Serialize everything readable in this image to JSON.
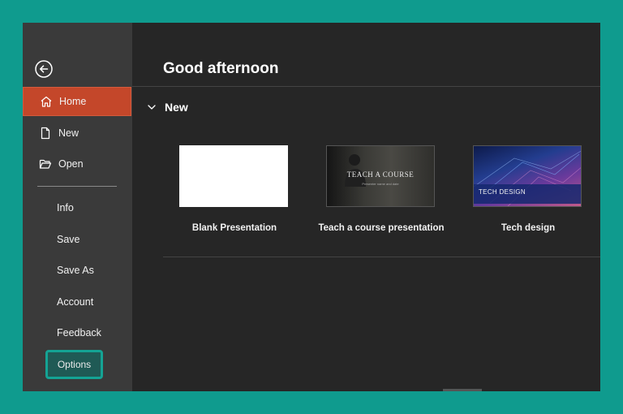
{
  "sidebar": {
    "home": "Home",
    "new": "New",
    "open": "Open",
    "info": "Info",
    "save": "Save",
    "save_as": "Save As",
    "account": "Account",
    "feedback": "Feedback",
    "options": "Options"
  },
  "main": {
    "greeting": "Good afternoon",
    "new_section": "New",
    "templates": [
      {
        "label": "Blank Presentation"
      },
      {
        "label": "Teach a course presentation",
        "thumb_title": "TEACH A COURSE",
        "thumb_subtitle": "Presenter name and date"
      },
      {
        "label": "Tech design",
        "thumb_title": "TECH DESIGN"
      }
    ]
  },
  "colors": {
    "frame": "#0f9b8e",
    "active_nav": "#c4472a",
    "options_highlight": "#14a394"
  },
  "icons": {
    "back": "back-arrow-icon",
    "home": "home-icon",
    "new": "new-document-icon",
    "open": "folder-open-icon",
    "collapse": "chevron-down-icon"
  }
}
